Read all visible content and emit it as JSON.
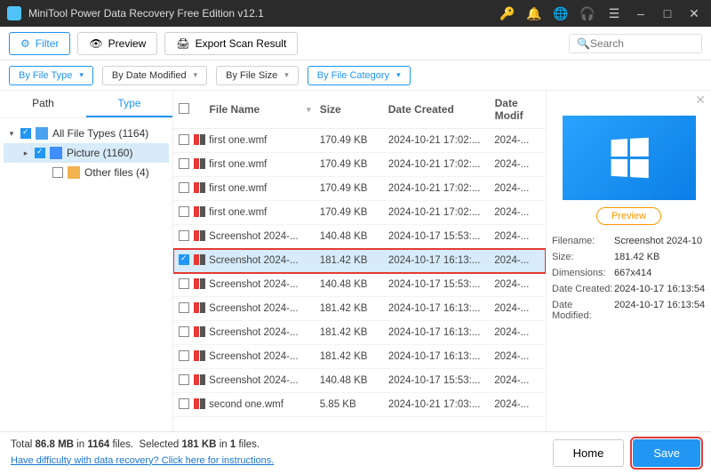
{
  "titlebar": {
    "title": "MiniTool Power Data Recovery Free Edition v12.1"
  },
  "toolbar": {
    "filter": "Filter",
    "preview": "Preview",
    "export": "Export Scan Result",
    "searchPlaceholder": "Search"
  },
  "filters": [
    "By File Type",
    "By Date Modified",
    "By File Size",
    "By File Category"
  ],
  "sidebar": {
    "tabs": [
      "Path",
      "Type"
    ],
    "tree": [
      {
        "label": "All File Types (1164)"
      },
      {
        "label": "Picture (1160)"
      },
      {
        "label": "Other files (4)"
      }
    ]
  },
  "list": {
    "columns": [
      "File Name",
      "Size",
      "Date Created",
      "Date Modif"
    ],
    "rows": [
      {
        "name": "first one.wmf",
        "size": "170.49 KB",
        "date": "2024-10-21 17:02:...",
        "mod": "2024-...",
        "checked": false
      },
      {
        "name": "first one.wmf",
        "size": "170.49 KB",
        "date": "2024-10-21 17:02:...",
        "mod": "2024-...",
        "checked": false
      },
      {
        "name": "first one.wmf",
        "size": "170.49 KB",
        "date": "2024-10-21 17:02:...",
        "mod": "2024-...",
        "checked": false
      },
      {
        "name": "first one.wmf",
        "size": "170.49 KB",
        "date": "2024-10-21 17:02:...",
        "mod": "2024-...",
        "checked": false
      },
      {
        "name": "Screenshot 2024-...",
        "size": "140.48 KB",
        "date": "2024-10-17 15:53:...",
        "mod": "2024-...",
        "checked": false
      },
      {
        "name": "Screenshot 2024-...",
        "size": "181.42 KB",
        "date": "2024-10-17 16:13:...",
        "mod": "2024-...",
        "checked": true
      },
      {
        "name": "Screenshot 2024-...",
        "size": "140.48 KB",
        "date": "2024-10-17 15:53:...",
        "mod": "2024-...",
        "checked": false
      },
      {
        "name": "Screenshot 2024-...",
        "size": "181.42 KB",
        "date": "2024-10-17 16:13:...",
        "mod": "2024-...",
        "checked": false
      },
      {
        "name": "Screenshot 2024-...",
        "size": "181.42 KB",
        "date": "2024-10-17 16:13:...",
        "mod": "2024-...",
        "checked": false
      },
      {
        "name": "Screenshot 2024-...",
        "size": "181.42 KB",
        "date": "2024-10-17 16:13:...",
        "mod": "2024-...",
        "checked": false
      },
      {
        "name": "Screenshot 2024-...",
        "size": "140.48 KB",
        "date": "2024-10-17 15:53:...",
        "mod": "2024-...",
        "checked": false
      },
      {
        "name": "second one.wmf",
        "size": "5.85 KB",
        "date": "2024-10-21 17:03:...",
        "mod": "2024-...",
        "checked": false
      }
    ]
  },
  "preview": {
    "button": "Preview",
    "meta": [
      {
        "k": "Filename:",
        "v": "Screenshot 2024-10"
      },
      {
        "k": "Size:",
        "v": "181.42 KB"
      },
      {
        "k": "Dimensions:",
        "v": "667x414"
      },
      {
        "k": "Date Created:",
        "v": "2024-10-17 16:13:54"
      },
      {
        "k": "Date Modified:",
        "v": "2024-10-17 16:13:54"
      }
    ]
  },
  "footer": {
    "status_pre": "Total",
    "status_in": "in",
    "status_files": "files.",
    "totalSize": "86.8 MB",
    "totalFiles": "1164",
    "selected_pre": "Selected",
    "selSize": "181 KB",
    "selFiles": "1",
    "helpLink": "Have difficulty with data recovery? Click here for instructions.",
    "home": "Home",
    "save": "Save"
  }
}
